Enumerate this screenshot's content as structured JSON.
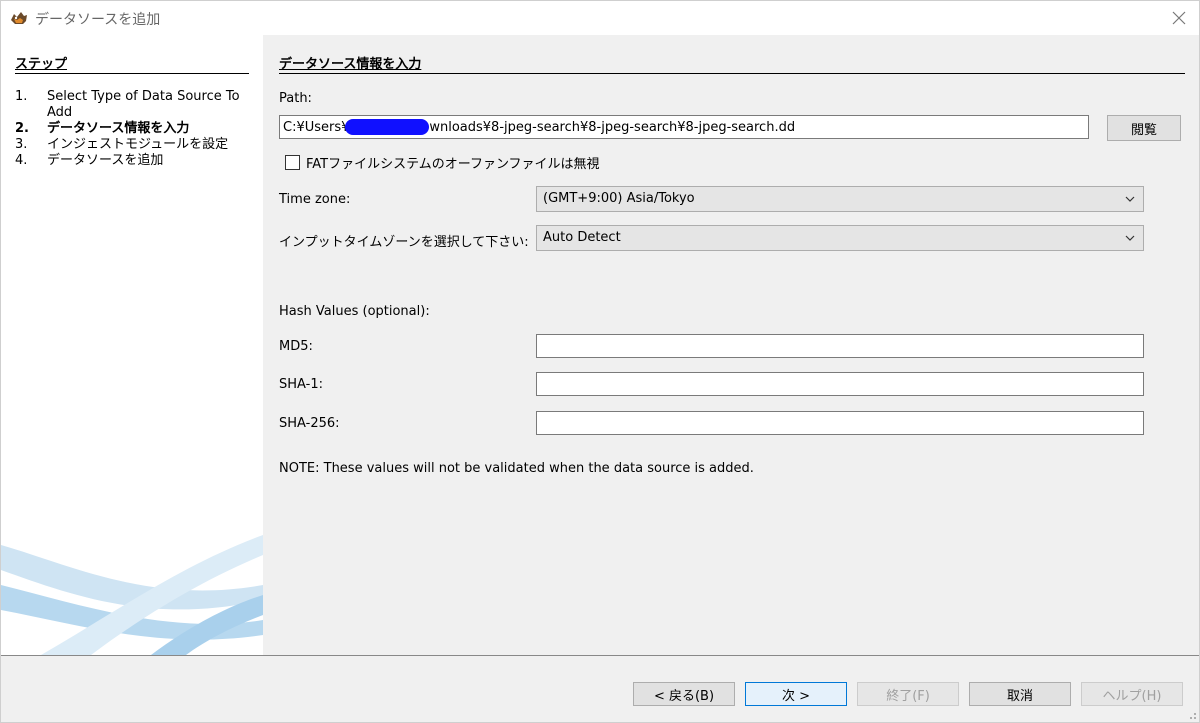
{
  "window": {
    "title": "データソースを追加"
  },
  "steps": {
    "heading": "ステップ",
    "items": [
      {
        "num": "1.",
        "label": "Select Type of Data Source To Add"
      },
      {
        "num": "2.",
        "label": "データソース情報を入力"
      },
      {
        "num": "3.",
        "label": "インジェストモジュールを設定"
      },
      {
        "num": "4.",
        "label": "データソースを追加"
      }
    ],
    "current_index": 1
  },
  "form": {
    "heading": "データソース情報を入力",
    "path_label": "Path:",
    "path_value": "C:¥Users¥             ¥Downloads¥8-jpeg-search¥8-jpeg-search¥8-jpeg-search.dd",
    "browse_label": "閲覧",
    "ignore_orphan_label": "FATファイルシステムのオーファンファイルは無視",
    "ignore_orphan_checked": false,
    "timezone_label": "Time zone:",
    "timezone_value": "(GMT+9:00) Asia/Tokyo",
    "input_timezone_label": "インプットタイムゾーンを選択して下さい:",
    "input_timezone_value": "Auto Detect",
    "hash_heading": "Hash Values (optional):",
    "md5_label": "MD5:",
    "sha1_label": "SHA-1:",
    "sha256_label": "SHA-256:",
    "md5_value": "",
    "sha1_value": "",
    "sha256_value": "",
    "note": "NOTE: These values will not be validated when the data source is added."
  },
  "footer": {
    "back_label": "< 戻る(B)",
    "next_label": "次 >",
    "finish_label": "終了(F)",
    "cancel_label": "取消",
    "help_label": "ヘルプ(H)"
  },
  "colors": {
    "content_bg": "#f0f0f0",
    "redaction": "#1010ff",
    "primary_border": "#0078d7"
  },
  "icons": {
    "app": "autopsy-dog-icon",
    "close": "close-icon",
    "dropdown": "chevron-down-icon",
    "grip": "resize-grip-icon"
  }
}
